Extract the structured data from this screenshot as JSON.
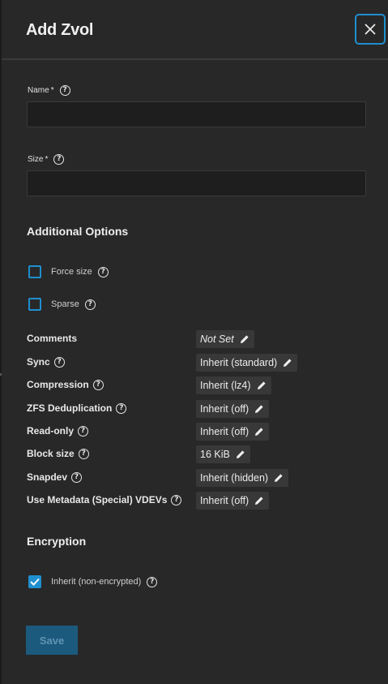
{
  "dialog": {
    "title": "Add Zvol",
    "close_icon": "close-icon"
  },
  "fields": {
    "name": {
      "label": "Name",
      "required_mark": "*",
      "value": "",
      "placeholder": ""
    },
    "size": {
      "label": "Size",
      "required_mark": "*",
      "value": "",
      "placeholder": ""
    }
  },
  "additional_options": {
    "title": "Additional Options",
    "force_size": {
      "label": "Force size",
      "checked": false
    },
    "sparse": {
      "label": "Sparse",
      "checked": false
    }
  },
  "properties": [
    {
      "label": "Comments",
      "value": "Not Set",
      "help": false,
      "notset": true
    },
    {
      "label": "Sync",
      "value": "Inherit (standard)",
      "help": true
    },
    {
      "label": "Compression",
      "value": "Inherit (lz4)",
      "help": true
    },
    {
      "label": "ZFS Deduplication",
      "value": "Inherit (off)",
      "help": true
    },
    {
      "label": "Read-only",
      "value": "Inherit (off)",
      "help": true
    },
    {
      "label": "Block size",
      "value": "16 KiB",
      "help": true
    },
    {
      "label": "Snapdev",
      "value": "Inherit (hidden)",
      "help": true
    },
    {
      "label": "Use Metadata (Special) VDEVs",
      "value": "Inherit (off)",
      "help": true
    }
  ],
  "encryption": {
    "title": "Encryption",
    "inherit": {
      "label": "Inherit (non-encrypted)",
      "checked": true
    }
  },
  "actions": {
    "save_label": "Save"
  },
  "colors": {
    "accent": "#1f8fcf",
    "panel_bg": "#282828",
    "input_bg": "#1e1e1e",
    "chip_bg": "#383838",
    "save_bg": "#1c5a7d"
  }
}
